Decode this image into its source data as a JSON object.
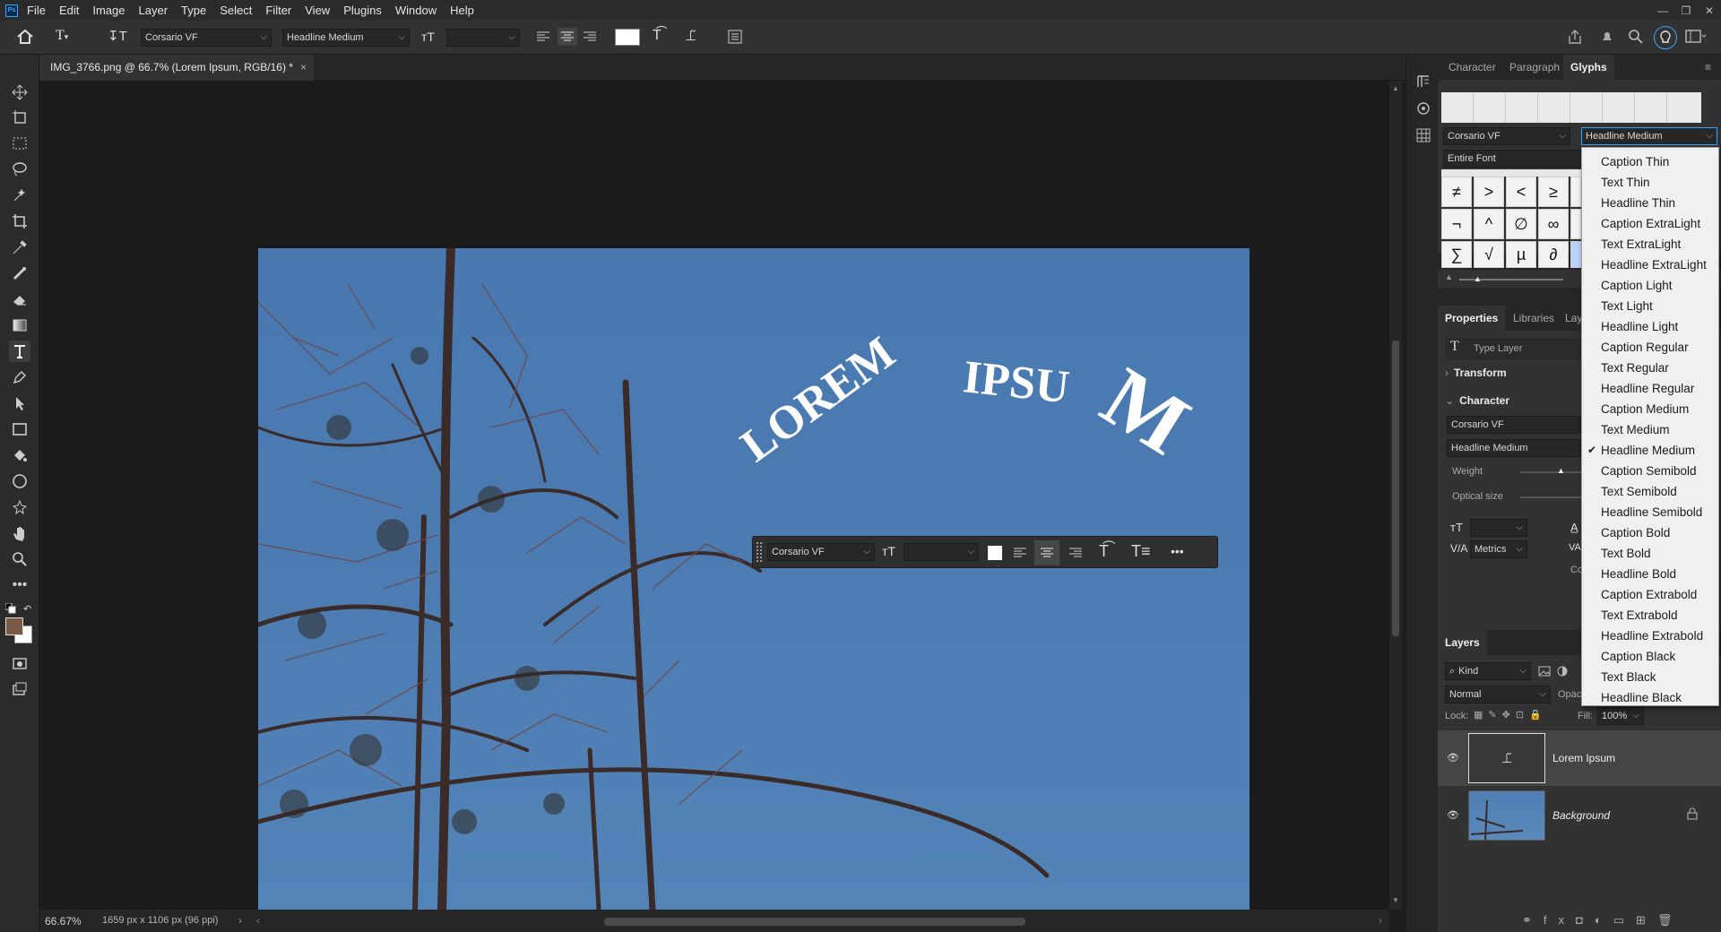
{
  "app": {
    "logo": "Ps"
  },
  "menu": [
    "File",
    "Edit",
    "Image",
    "Layer",
    "Type",
    "Select",
    "Filter",
    "View",
    "Plugins",
    "Window",
    "Help"
  ],
  "options": {
    "font_family": "Corsario VF",
    "font_style": "Headline Medium",
    "font_size": ""
  },
  "document": {
    "tab_title": "IMG_3766.png @ 66.7% (Lorem Ipsum, RGB/16) *",
    "canvas_text": "LOREM IPSUM"
  },
  "contextual": {
    "font_family": "Corsario VF",
    "font_size": ""
  },
  "status": {
    "zoom": "66.67%",
    "info": "1659 px x 1106 px (96 ppi)"
  },
  "glyphs": {
    "tabs": [
      "Character",
      "Paragraph",
      "Glyphs"
    ],
    "font_family": "Corsario VF",
    "font_style": "Headline Medium",
    "filter": "Entire Font",
    "rows": [
      [
        "≠",
        ">",
        "<",
        "≥"
      ],
      [
        "¬",
        "^",
        "∅",
        "∞"
      ],
      [
        "∑",
        "√",
        "µ",
        "∂"
      ]
    ]
  },
  "properties": {
    "tabs": [
      "Properties",
      "Libraries",
      "Lay"
    ],
    "layer_type": "Type Layer",
    "transform": "Transform",
    "character": "Character",
    "font_family": "Corsario VF",
    "font_style": "Headline Medium",
    "weight_label": "Weight",
    "optical_label": "Optical size",
    "kerning": "Metrics",
    "color_label": "Colo"
  },
  "layers": {
    "title": "Layers",
    "filter": "Kind",
    "blend": "Normal",
    "opacity_label": "Opac",
    "lock_label": "Lock:",
    "fill_label": "Fill:",
    "fill_value": "100%",
    "items": [
      {
        "name": "Lorem Ipsum"
      },
      {
        "name": "Background"
      }
    ]
  },
  "style_menu": {
    "selected": "Headline Medium",
    "options": [
      "Caption Thin",
      "Text Thin",
      "Headline Thin",
      "Caption ExtraLight",
      "Text ExtraLight",
      "Headline ExtraLight",
      "Caption Light",
      "Text Light",
      "Headline Light",
      "Caption Regular",
      "Text Regular",
      "Headline Regular",
      "Caption Medium",
      "Text Medium",
      "Headline Medium",
      "Caption Semibold",
      "Text Semibold",
      "Headline Semibold",
      "Caption Bold",
      "Text Bold",
      "Headline Bold",
      "Caption Extrabold",
      "Text Extrabold",
      "Headline Extrabold",
      "Caption Black",
      "Text Black",
      "Headline Black"
    ]
  },
  "colors": {
    "accent": "#31a8ff",
    "sky": "#4b7ab2",
    "fg_swatch": "#7a5a45"
  }
}
